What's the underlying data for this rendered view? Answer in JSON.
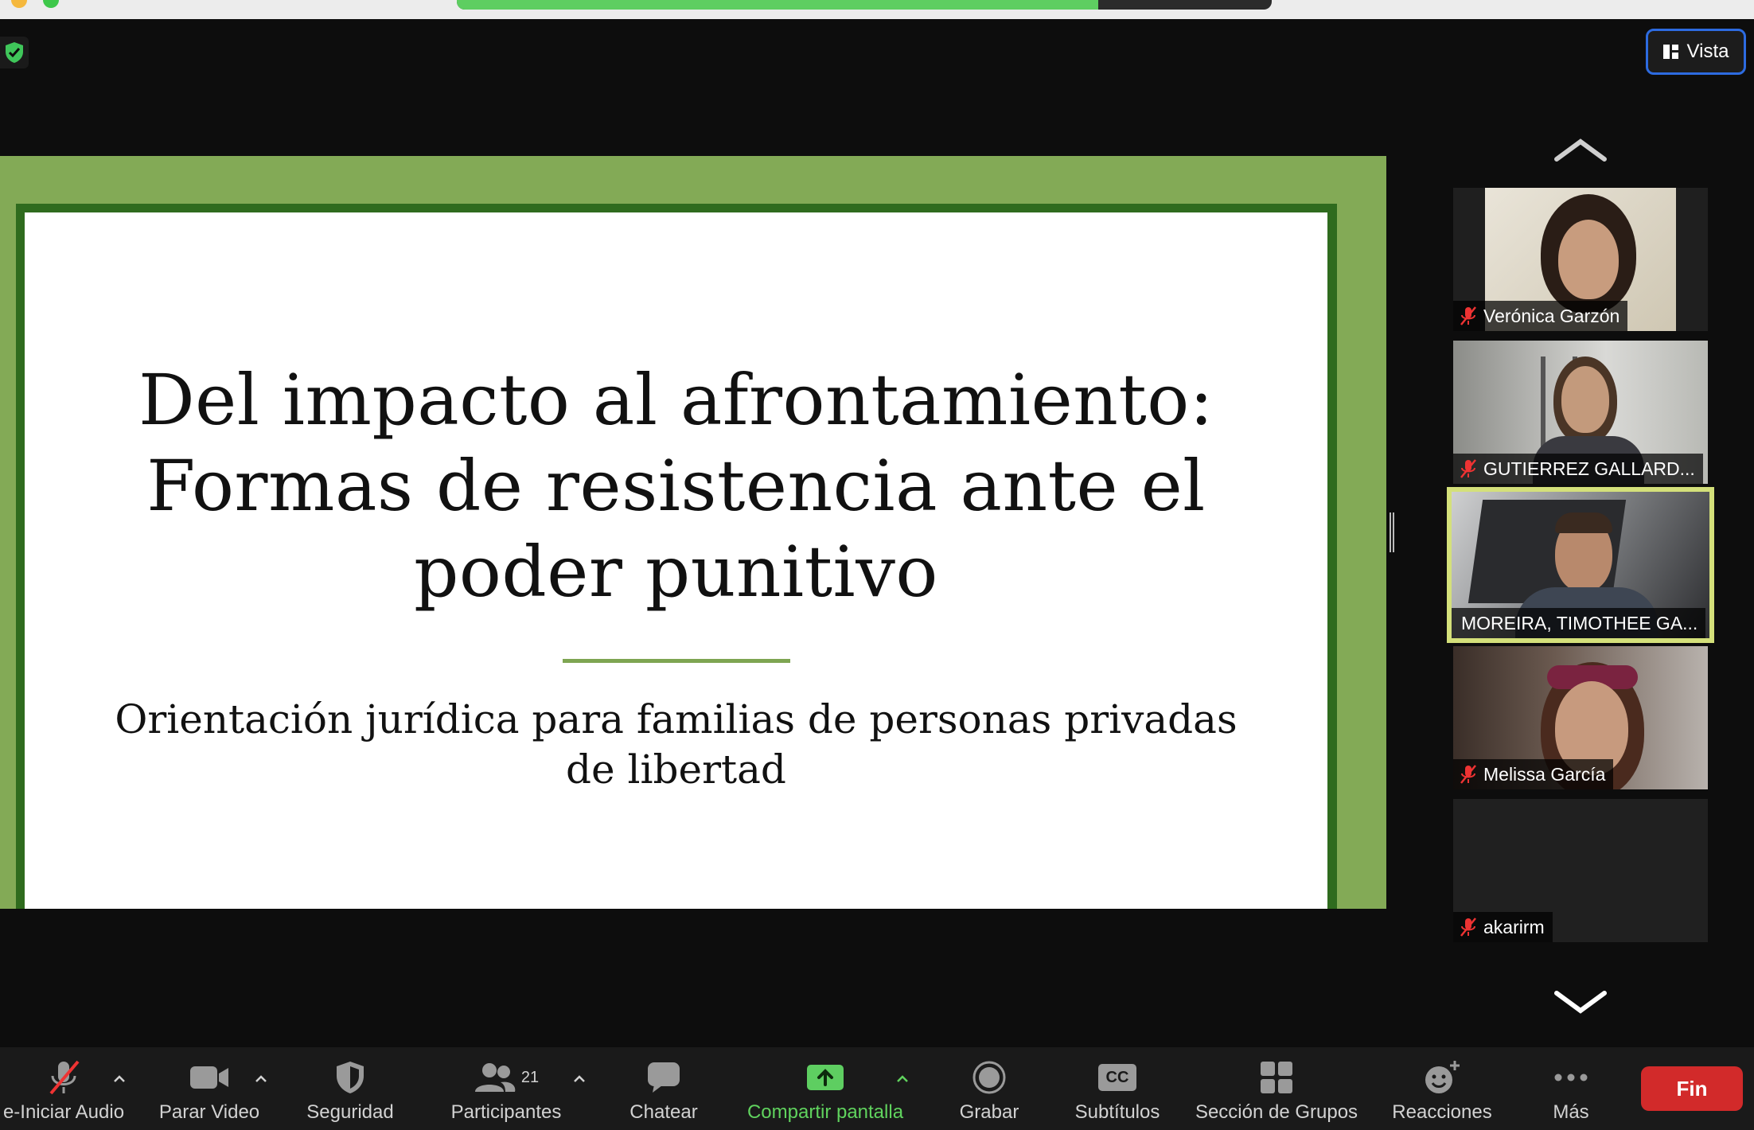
{
  "view_button": {
    "label": "Vista"
  },
  "share_progress": 0.787,
  "slide": {
    "title_lines": [
      "Del impacto al afrontamiento:",
      "Formas de resistencia ante el",
      "poder punitivo"
    ],
    "subtitle_lines": [
      "Orientación jurídica para familias de personas privadas",
      "de libertad"
    ]
  },
  "participants": [
    {
      "name": "Verónica Garzón",
      "muted": true
    },
    {
      "name": "GUTIERREZ GALLARD...",
      "muted": true
    },
    {
      "name": "MOREIRA, TIMOTHEE GA...",
      "muted": false,
      "active_speaker": true
    },
    {
      "name": "Melissa García",
      "muted": true
    },
    {
      "name": "akarirm",
      "muted": true
    }
  ],
  "toolbar": {
    "audio_label": "e-Iniciar Audio",
    "video_label": "Parar Video",
    "security_label": "Seguridad",
    "participants_label": "Participantes",
    "participants_count": "21",
    "chat_label": "Chatear",
    "share_label": "Compartir pantalla",
    "record_label": "Grabar",
    "captions_label": "Subtítulos",
    "captions_badge": "CC",
    "breakout_label": "Sección de Grupos",
    "reactions_label": "Reacciones",
    "more_label": "Más",
    "end_label": "Fin"
  },
  "colors": {
    "slide_green": "#83aa56",
    "frame_green": "#2f6b1e",
    "share_green": "#60d35e",
    "end_red": "#d22a2a",
    "active_border": "#d4e07a"
  }
}
